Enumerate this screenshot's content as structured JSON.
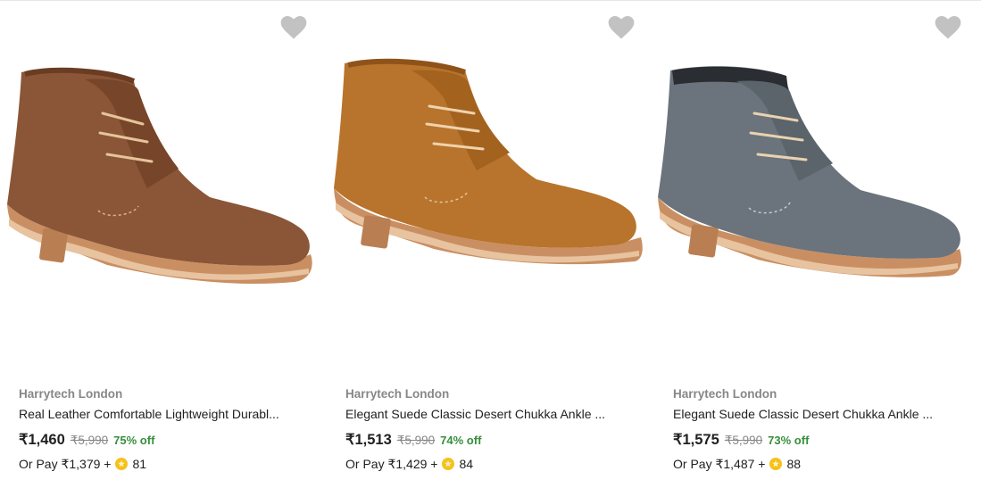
{
  "colors": {
    "brand_text": "#878787",
    "discount": "#388e3c",
    "wishlist": "#c2c2c2",
    "coin": "#f6c11b"
  },
  "products": [
    {
      "brand": "Harrytech London",
      "title": "Real Leather Comfortable Lightweight Durabl...",
      "price": "₹1,460",
      "mrp": "₹5,990",
      "discount": "75% off",
      "pay_prefix": "Or Pay ₹1,379 +",
      "coins": "81",
      "shoe_color": "brown"
    },
    {
      "brand": "Harrytech London",
      "title": "Elegant Suede Classic Desert Chukka Ankle ...",
      "price": "₹1,513",
      "mrp": "₹5,990",
      "discount": "74% off",
      "pay_prefix": "Or Pay ₹1,429 +",
      "coins": "84",
      "shoe_color": "tan"
    },
    {
      "brand": "Harrytech London",
      "title": "Elegant Suede Classic Desert Chukka Ankle ...",
      "price": "₹1,575",
      "mrp": "₹5,990",
      "discount": "73% off",
      "pay_prefix": "Or Pay ₹1,487 +",
      "coins": "88",
      "shoe_color": "grey"
    }
  ]
}
